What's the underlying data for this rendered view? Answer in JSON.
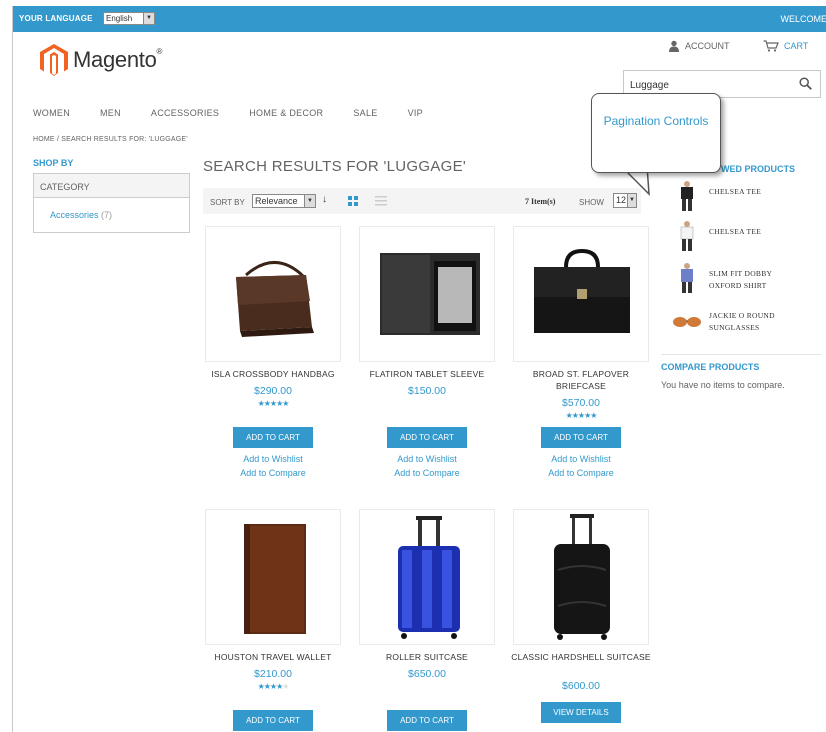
{
  "topbar": {
    "language_label": "YOUR LANGUAGE",
    "language_value": "English",
    "welcome": "WELCOME"
  },
  "header": {
    "brand": "Magento",
    "account": "ACCOUNT",
    "cart": "CART",
    "search_value": "Luggage"
  },
  "nav": [
    "WOMEN",
    "MEN",
    "ACCESSORIES",
    "HOME & DECOR",
    "SALE",
    "VIP"
  ],
  "breadcrumb": "HOME / SEARCH RESULTS FOR: 'LUGGAGE'",
  "sidebar_left": {
    "shop_by": "SHOP BY",
    "category_header": "CATEGORY",
    "category_name": "Accessories",
    "category_count": "(7)"
  },
  "page_title": "SEARCH RESULTS FOR 'LUGGAGE'",
  "toolbar": {
    "sort_by": "SORT BY",
    "sort_value": "Relevance",
    "items_count": "7 Item(s)",
    "show_label": "SHOW",
    "show_value": "12"
  },
  "products": [
    {
      "name": "ISLA CROSSBODY HANDBAG",
      "price": "$290.00",
      "stars": "★★★★★",
      "stars_off": "",
      "rating": 4.5,
      "button": "ADD TO CART",
      "wishlist": "Add to Wishlist",
      "compare": "Add to Compare"
    },
    {
      "name": "FLATIRON TABLET SLEEVE",
      "price": "$150.00",
      "stars": "",
      "stars_off": "",
      "button": "ADD TO CART",
      "wishlist": "Add to Wishlist",
      "compare": "Add to Compare"
    },
    {
      "name": "BROAD ST. FLAPOVER BRIEFCASE",
      "price": "$570.00",
      "stars": "★★★★★",
      "stars_off": "",
      "rating": 4.5,
      "button": "ADD TO CART",
      "wishlist": "Add to Wishlist",
      "compare": "Add to Compare"
    },
    {
      "name": "HOUSTON TRAVEL WALLET",
      "price": "$210.00",
      "stars": "★★★★",
      "stars_off": "★",
      "rating": 4,
      "button": "ADD TO CART"
    },
    {
      "name": "ROLLER SUITCASE",
      "price": "$650.00",
      "stars": "",
      "stars_off": "",
      "button": "ADD TO CART"
    },
    {
      "name": "CLASSIC HARDSHELL SUITCASE",
      "price": "$600.00",
      "stars": "",
      "stars_off": "",
      "button": "VIEW DETAILS"
    }
  ],
  "sidebar_right": {
    "viewed_heading": "WED PRODUCTS",
    "viewed": [
      "CHELSEA TEE",
      "CHELSEA TEE",
      "SLIM FIT DOBBY OXFORD SHIRT",
      "JACKIE O ROUND SUNGLASSES"
    ],
    "compare_heading": "COMPARE PRODUCTS",
    "compare_text": "You have no items to compare."
  },
  "callout": "Pagination Controls",
  "colors": {
    "accent": "#3399cc",
    "logo_orange": "#f26322",
    "text": "#636363"
  }
}
